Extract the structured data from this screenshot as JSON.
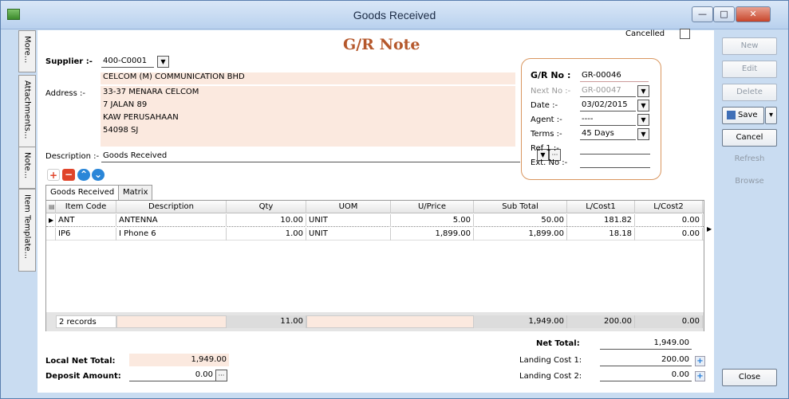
{
  "window": {
    "title": "Goods Received",
    "min": "—",
    "max": "□",
    "close": "✕"
  },
  "side_tabs": [
    "More...",
    "Attachments...",
    "Note...",
    "Item Template..."
  ],
  "form": {
    "heading": "G/R Note",
    "cancelled_label": "Cancelled",
    "supplier_label": "Supplier :-",
    "supplier_code": "400-C0001",
    "supplier_name": "CELCOM (M) COMMUNICATION BHD",
    "address_label": "Address :-",
    "address": [
      "33-37 MENARA CELCOM",
      "7 JALAN 89",
      "KAW PERUSAHAAN",
      "54098 SJ"
    ],
    "description_label": "Description :-",
    "description": "Goods Received"
  },
  "gr": {
    "no_label": "G/R No :",
    "no": "GR-00046",
    "next_label": "Next No :-",
    "next": "GR-00047",
    "date_label": "Date :-",
    "date": "03/02/2015",
    "agent_label": "Agent :-",
    "agent": "----",
    "terms_label": "Terms :-",
    "terms": "45 Days",
    "ref_label": "Ref 1 :-",
    "ext_label": "Ext. No :-"
  },
  "tabs": [
    "Goods Received",
    "Matrix"
  ],
  "grid": {
    "columns": [
      "Item Code",
      "Description",
      "Qty",
      "UOM",
      "U/Price",
      "Sub Total",
      "L/Cost1",
      "L/Cost2"
    ],
    "rows": [
      [
        "ANT",
        "ANTENNA",
        "10.00",
        "UNIT",
        "5.00",
        "50.00",
        "181.82",
        "0.00"
      ],
      [
        "IP6",
        "I Phone 6",
        "1.00",
        "UNIT",
        "1,899.00",
        "1,899.00",
        "18.18",
        "0.00"
      ]
    ],
    "footer": {
      "records": "2 records",
      "qty": "11.00",
      "sub_total": "1,949.00",
      "lcost1": "200.00",
      "lcost2": "0.00"
    }
  },
  "totals": {
    "local_net_label": "Local Net Total:",
    "local_net": "1,949.00",
    "deposit_label": "Deposit Amount:",
    "deposit": "0.00",
    "net_label": "Net Total:",
    "net": "1,949.00",
    "lc1_label": "Landing Cost 1:",
    "lc1": "200.00",
    "lc2_label": "Landing Cost 2:",
    "lc2": "0.00"
  },
  "sidebar": {
    "new": "New",
    "edit": "Edit",
    "delete": "Delete",
    "save": "Save",
    "cancel": "Cancel",
    "refresh": "Refresh",
    "browse": "Browse",
    "close": "Close"
  }
}
